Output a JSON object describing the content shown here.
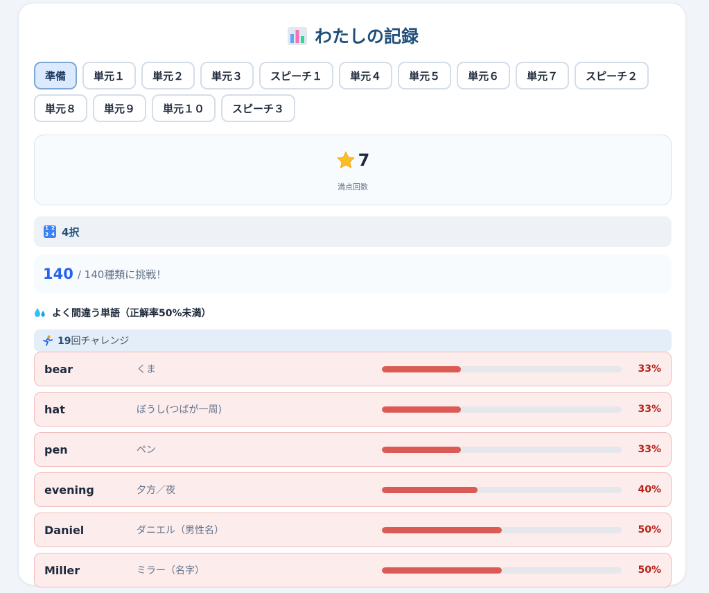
{
  "page": {
    "title": "わたしの記録",
    "title_icon": "bar-chart-icon"
  },
  "tabs": [
    {
      "label": "準備",
      "active": true
    },
    {
      "label": "単元１",
      "active": false
    },
    {
      "label": "単元２",
      "active": false
    },
    {
      "label": "単元３",
      "active": false
    },
    {
      "label": "スピーチ１",
      "active": false
    },
    {
      "label": "単元４",
      "active": false
    },
    {
      "label": "単元５",
      "active": false
    },
    {
      "label": "単元６",
      "active": false
    },
    {
      "label": "単元７",
      "active": false
    },
    {
      "label": "スピーチ２",
      "active": false
    },
    {
      "label": "単元８",
      "active": false
    },
    {
      "label": "単元９",
      "active": false
    },
    {
      "label": "単元１０",
      "active": false
    },
    {
      "label": "スピーチ３",
      "active": false
    }
  ],
  "summary": {
    "perfect_count": "7",
    "perfect_label": "満点回数",
    "icon": "star-icon"
  },
  "mode": {
    "label": "4択",
    "icon": "numbers-grid-icon"
  },
  "challenge": {
    "count": "140",
    "total_text": "/ 140種類に挑戦！"
  },
  "weak_words": {
    "title": "よく間違う単語（正解率50%未満）",
    "icon": "sweat-drops-icon",
    "tries_count": "19",
    "tries_suffix": "回チャレンジ",
    "tries_icon": "running-person-icon",
    "items": [
      {
        "en": "bear",
        "ja": "くま",
        "rate": 33,
        "rate_text": "33%"
      },
      {
        "en": "hat",
        "ja": "ぼうし(つばが一周)",
        "rate": 33,
        "rate_text": "33%"
      },
      {
        "en": "pen",
        "ja": "ペン",
        "rate": 33,
        "rate_text": "33%"
      },
      {
        "en": "evening",
        "ja": "夕方／夜",
        "rate": 40,
        "rate_text": "40%"
      },
      {
        "en": "Daniel",
        "ja": "ダニエル（男性名）",
        "rate": 50,
        "rate_text": "50%"
      },
      {
        "en": "Miller",
        "ja": "ミラー（名字）",
        "rate": 50,
        "rate_text": "50%"
      }
    ]
  },
  "colors": {
    "accent": "#1f4e79",
    "active_tab_bg": "#dbeafe",
    "bar_fill": "#dc5a54",
    "row_bg": "#fdecec",
    "rate_text": "#b42318"
  }
}
